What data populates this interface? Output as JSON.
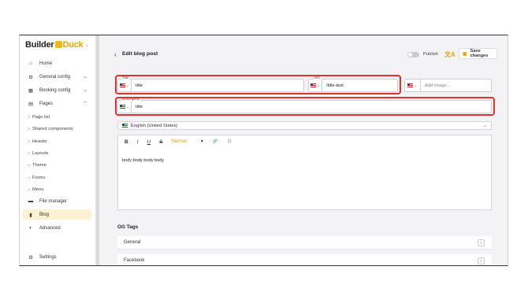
{
  "app": {
    "logo_pre": "Builder",
    "logo_post": "Duck",
    "collapse_icon": "‹"
  },
  "sidebar": {
    "items": [
      {
        "label": "Home",
        "icon": "⌂"
      },
      {
        "label": "General config",
        "icon": "⚙",
        "chevron": "⌄"
      },
      {
        "label": "Booking config",
        "icon": "▦",
        "chevron": "⌄"
      },
      {
        "label": "Pages",
        "icon": "▤",
        "chevron": "⌃"
      },
      {
        "label": "File manager",
        "icon": "▬"
      },
      {
        "label": "Blog",
        "icon": "▮"
      },
      {
        "label": "Advanced",
        "icon": "◐"
      },
      {
        "label": "Settings",
        "icon": "⚙"
      }
    ],
    "subitems": [
      "Page list",
      "Shared components",
      "Header",
      "Layouts",
      "Theme",
      "Forms",
      "Menu"
    ]
  },
  "header": {
    "back_icon": "‹",
    "title": "Edit blog post",
    "publish_label": "Publish",
    "translate_icon": "文A",
    "save_icon": "▣",
    "save_label": "Save changes"
  },
  "form": {
    "title_label": "Title",
    "title_value": "title",
    "url_label": "URL",
    "url_value": "/title-test",
    "image_placeholder": "Add image...",
    "description_label": "Description",
    "description_value": "title"
  },
  "language": {
    "selected": "English (United States)"
  },
  "toolbar": {
    "bold": "B",
    "italic": "I",
    "underline": "U",
    "strike": "S",
    "heading": "Normal",
    "heading_arrow": "▼",
    "link": "🔗",
    "unlink": "⛓"
  },
  "editor": {
    "content": "body body body body"
  },
  "og": {
    "title": "OG Tags",
    "rows": [
      {
        "label": "General"
      },
      {
        "label": "Facebook"
      }
    ]
  },
  "colors": {
    "accent": "#f0a500",
    "highlight": "#e0312c",
    "active_bg": "#fdf1d2"
  }
}
